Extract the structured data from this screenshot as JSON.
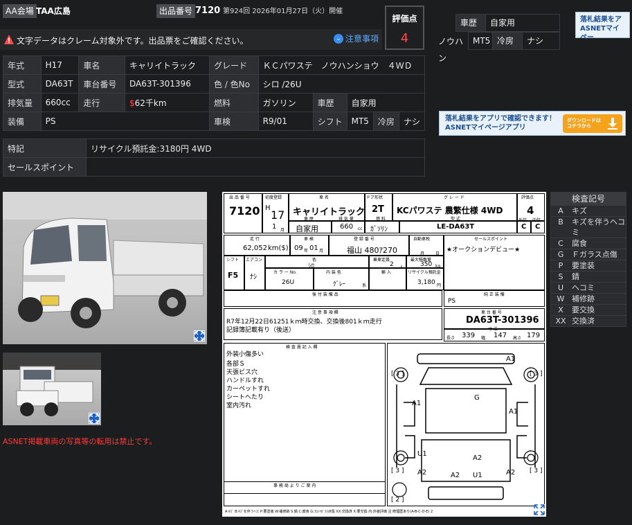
{
  "header": {
    "venue_label": "AA会場",
    "venue": "TAA広島",
    "lot_label": "出品番号",
    "lot_no": "7120",
    "session": "第924回 2026年01月27日（火）開催"
  },
  "notice": {
    "text": "文字データはクレーム対象外です。出品票をご確認ください。",
    "link": "注意事項"
  },
  "score": {
    "label": "評価点",
    "value": "4"
  },
  "spec": {
    "r1": {
      "k1": "年式",
      "v1": "H17",
      "k2": "車名",
      "v2": "キャリイトラック",
      "k3": "グレード",
      "v3": "ＫＣパワステ　ノウハンショウ　４ＷＤ"
    },
    "r2": {
      "k1": "型式",
      "v1": "DA63T",
      "k2": "車台番号",
      "v2": "DA63T-301396",
      "k3": "色 / 色No",
      "v3": "シロ /26U"
    },
    "r3": {
      "k1": "排気量",
      "v1": "660cc",
      "k2": "走行",
      "v2_sym": "$",
      "v2": "62千km",
      "k3": "燃料",
      "v3": "ガソリン",
      "k4": "車歴",
      "v4": "自家用"
    },
    "r4": {
      "k1": "装備",
      "v1": "PS",
      "k3": "車検",
      "v3": "R9/01",
      "k4": "シフト",
      "v4": "MT5",
      "k5": "冷房",
      "v5": "ナシ"
    }
  },
  "spec2": {
    "k1": "特記",
    "v1": "リサイクル預託金:3180円 4WD",
    "k2": "セールスポイント",
    "v2": ""
  },
  "fragments": {
    "history_k": "車歴",
    "history_v": "自家用",
    "grade_tail": "ノウハン",
    "shift": "MT5",
    "ac_k": "冷房",
    "ac_v": "ナシ"
  },
  "banner": {
    "top": "落札結果をア",
    "top_sub": "ASNETマイペー",
    "main": "落札結果をアプリで確認できます！",
    "main_sub": "ASNETマイページアプリ",
    "btn1": "ダウンロードは",
    "btn2": "コチラから"
  },
  "photo_warning": "ASNET掲載車両の写真等の転用は禁止です。",
  "sheet": {
    "h_lot": "出 品 番 号",
    "lot": "7120",
    "h_first": "初度登録",
    "era": "H",
    "year": "17",
    "month": "1",
    "month_u": "月",
    "h_name": "車 名",
    "name": "キャリイトラック",
    "h_door": "ドア形状",
    "door": "2T",
    "h_grade": "グ レ ー ド",
    "grade": "KCパワステ 農繁仕様 4WD",
    "h_score": "評価点",
    "score": "4",
    "h_hist": "車 歴",
    "hist": "自家用",
    "h_disp": "排 気 量",
    "disp": "660",
    "disp_u": "cc",
    "h_fuel": "燃 料",
    "fuel": "ｶﾞｿﾘﾝ",
    "h_model": "型 式",
    "model": "LE-DA63T",
    "h_ext": "外装",
    "ext": "C",
    "h_int": "内装",
    "int": "C",
    "h_odo": "走 行",
    "odo": "62,052",
    "odo_u": "km($)",
    "h_insp": "車 検",
    "insp_y": "09",
    "insp_yu": "年",
    "insp_m": "01",
    "insp_mu": "月",
    "h_plate": "登 録 番 号",
    "plate": "福山 480ｱ270",
    "h_tax": "自動車税",
    "tax_m": "月",
    "tax_d": "日",
    "h_sales": "セールスポイント",
    "sales": "★オークションデビュー★",
    "h_shift": "シフト",
    "shift": "F5",
    "h_ac": "エアコン",
    "ac": "ﾅｼ",
    "h_color": "色",
    "color": "ｼﾛ",
    "h_cap": "乗車定員",
    "cap": "2",
    "cap_u": "人",
    "h_load": "最大積載量",
    "load": "350",
    "load_u": "kg",
    "h_cno": "カ ラ ー No.",
    "cno": "26U",
    "h_icolor": "内 装 色",
    "icolor": "ｸﾞﾚｰ",
    "icolor_u": "系",
    "h_import": "輸 入",
    "h_recycle": "リサイクル預託金",
    "recycle": "3,180",
    "recycle_u": "円",
    "h_rear": "後 付 装 備 品",
    "h_equip": "純 正 装 備",
    "equip": "PS",
    "h_notes": "注 意 事 項 欄",
    "notes1": "R7年12月22日61251ｋｍ時交換、交換後801ｋｍ走行",
    "notes2": "記録簿記載有り（後送）",
    "h_chassis": "車 台 番 号",
    "chassis": "DA63T-301396",
    "h_dims": "寸 法",
    "len_k": "長さ",
    "len": "339",
    "wid_k": "幅",
    "wid": "147",
    "hgt_k": "高さ",
    "hgt": "179",
    "h_inspector": "検 査 員 記 入 欄",
    "insp_lines": [
      "外装小傷多い",
      "各部Ｓ",
      "天張ビス穴",
      "ハンドルすれ",
      "カーペットすれ",
      "シートへたり",
      "室内汚れ"
    ],
    "h_dealer": "事 務 局 よ り ご 案 内",
    "marks": {
      "a1_top": "A1",
      "g": "G",
      "a1_l": "A1",
      "a1_r": "A1",
      "u1_l": "U1",
      "a2_c": "A2",
      "a2_l": "A2",
      "a2_b1": "A2",
      "u1_b": "U1",
      "a2_r": "A2",
      "b3_tl": "[ 3 ]",
      "b3_tr": "[ 3 ]",
      "b3_bl": "[ 3 ]",
      "b3_br": "[ 3 ]",
      "b2": "[ 2 ]"
    },
    "footer": "A:ｷｽﾞ  B:ｷｽﾞを伴うﾍｺﾐ  P:要塗装  W:補修跡  S:錆  C:腐食  G:ﾌﾛﾝﾄｶﾞﾗｽ点傷  XX:交換済  X:要交換  内:外装評価  注:修理歴あり(A-B-C-D-E)  2"
  },
  "legend": {
    "title": "検査記号",
    "rows": [
      {
        "c": "A",
        "d": "キズ"
      },
      {
        "c": "B",
        "d": "キズを伴うヘコミ"
      },
      {
        "c": "C",
        "d": "腐食"
      },
      {
        "c": "G",
        "d": "Ｆガラス点傷"
      },
      {
        "c": "P",
        "d": "要塗装"
      },
      {
        "c": "S",
        "d": "錆"
      },
      {
        "c": "U",
        "d": "ヘコミ"
      },
      {
        "c": "W",
        "d": "補修跡"
      },
      {
        "c": "X",
        "d": "要交換"
      },
      {
        "c": "XX",
        "d": "交換済"
      }
    ]
  },
  "colors": {
    "accent_red": "#ff4a4a",
    "link_blue": "#5aa8ff",
    "download_orange": "#f5a21d"
  }
}
